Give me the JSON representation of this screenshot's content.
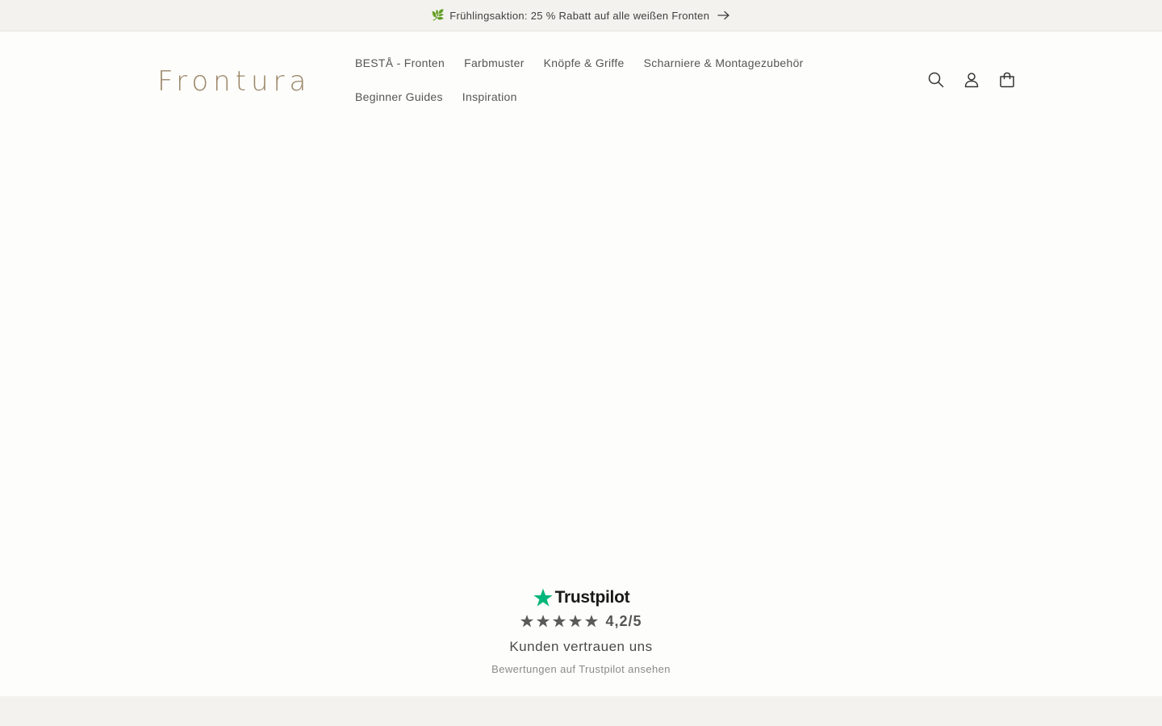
{
  "announcement": {
    "emoji": "🌿",
    "text": "Frühlingsaktion: 25 % Rabatt auf alle weißen Fronten"
  },
  "header": {
    "logo": "Frontura",
    "nav": {
      "row1": [
        "BESTÅ - Fronten",
        "Farbmuster",
        "Knöpfe & Griffe",
        "Scharniere & Montagezubehör"
      ],
      "row2": [
        "Beginner Guides",
        "Inspiration"
      ]
    },
    "icons": [
      "search-icon",
      "account-icon",
      "cart-icon"
    ]
  },
  "trustpilot": {
    "brand": "Trustpilot",
    "score": "4,2/5",
    "stars": 5,
    "headline": "Kunden vertrauen uns",
    "link": "Bewertungen auf Trustpilot ansehen"
  },
  "colors": {
    "background": "#fdfdfb",
    "announcement_bg": "#f3f2ee",
    "logo": "#9c8769",
    "trustpilot_green": "#00b67a",
    "star_gray": "#5a5a5a"
  }
}
